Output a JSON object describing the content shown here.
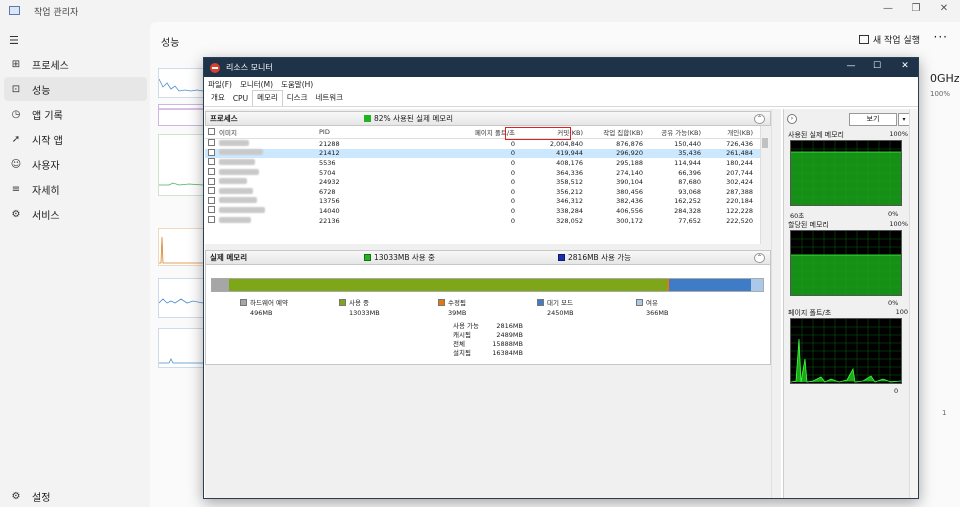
{
  "taskmgr": {
    "title": "작업 관리자",
    "nav": [
      "프로세스",
      "성능",
      "앱 기록",
      "시작 앱",
      "사용자",
      "자세히",
      "서비스"
    ],
    "settings": "설정",
    "main_title": "성능",
    "run_task": "새 작업 실행",
    "ghz": "0GHz",
    "pct100": "100%",
    "one": "1"
  },
  "resmon": {
    "title": "리소스 모니터",
    "menu": [
      "파일(F)",
      "모니터(M)",
      "도움말(H)"
    ],
    "tabs": [
      "개요",
      "CPU",
      "메모리",
      "디스크",
      "네트워크"
    ],
    "active_tab": "메모리",
    "process_section": {
      "title": "프로세스",
      "legend": "82% 사용된 실제 메모리",
      "legend_color": "#22b322",
      "columns": [
        "이미지",
        "PID",
        "페이지 폴트/초",
        "커밋(KB)",
        "작업 집합(KB)",
        "공유 가능(KB)",
        "개인(KB)"
      ],
      "rows": [
        {
          "pid": "21288",
          "fault": "0",
          "commit": "2,004,840",
          "ws": "876,876",
          "share": "150,440",
          "priv": "726,436"
        },
        {
          "pid": "21412",
          "fault": "0",
          "commit": "419,944",
          "ws": "296,920",
          "share": "35,436",
          "priv": "261,484"
        },
        {
          "pid": "5536",
          "fault": "0",
          "commit": "408,176",
          "ws": "295,188",
          "share": "114,944",
          "priv": "180,244"
        },
        {
          "pid": "5704",
          "fault": "0",
          "commit": "364,336",
          "ws": "274,140",
          "share": "66,396",
          "priv": "207,744"
        },
        {
          "pid": "24932",
          "fault": "0",
          "commit": "358,512",
          "ws": "390,104",
          "share": "87,680",
          "priv": "302,424"
        },
        {
          "pid": "6728",
          "fault": "0",
          "commit": "356,212",
          "ws": "380,456",
          "share": "93,068",
          "priv": "287,388"
        },
        {
          "pid": "13756",
          "fault": "0",
          "commit": "346,312",
          "ws": "382,436",
          "share": "162,252",
          "priv": "220,184"
        },
        {
          "pid": "14040",
          "fault": "0",
          "commit": "338,284",
          "ws": "406,556",
          "share": "284,328",
          "priv": "122,228"
        },
        {
          "pid": "22136",
          "fault": "0",
          "commit": "328,052",
          "ws": "300,172",
          "share": "77,652",
          "priv": "222,520"
        }
      ]
    },
    "memory_section": {
      "title": "실제 메모리",
      "legend_used": "13033MB 사용 중",
      "legend_free": "2816MB 사용 가능",
      "bar": [
        {
          "label": "하드웨어 예약",
          "value": "496MB",
          "color": "#a6a6a6",
          "fraction": 0.031
        },
        {
          "label": "사용 중",
          "value": "13033MB",
          "color": "#7da619",
          "fraction": 0.795
        },
        {
          "label": "수정됨",
          "value": "39MB",
          "color": "#e07a10",
          "fraction": 0.003
        },
        {
          "label": "대기 모드",
          "value": "2450MB",
          "color": "#3e7cc7",
          "fraction": 0.149
        },
        {
          "label": "여유",
          "value": "366MB",
          "color": "#a9c8ea",
          "fraction": 0.022
        }
      ],
      "stats": [
        {
          "k": "사용 가능",
          "v": "2816MB"
        },
        {
          "k": "캐시됨",
          "v": "2489MB"
        },
        {
          "k": "전체",
          "v": "15888MB"
        },
        {
          "k": "설치됨",
          "v": "16384MB"
        }
      ]
    },
    "right_panel": {
      "view_btn": "보기",
      "graphs": [
        {
          "title": "사용된 실제 메모리",
          "top": "100%",
          "bottom_left": "60초",
          "bottom_right": "0%"
        },
        {
          "title": "할당된 메모리",
          "top": "100%",
          "bottom_left": "",
          "bottom_right": "0%"
        },
        {
          "title": "페이지 폴트/초",
          "top": "100",
          "bottom_left": "",
          "bottom_right": "0"
        }
      ]
    }
  }
}
